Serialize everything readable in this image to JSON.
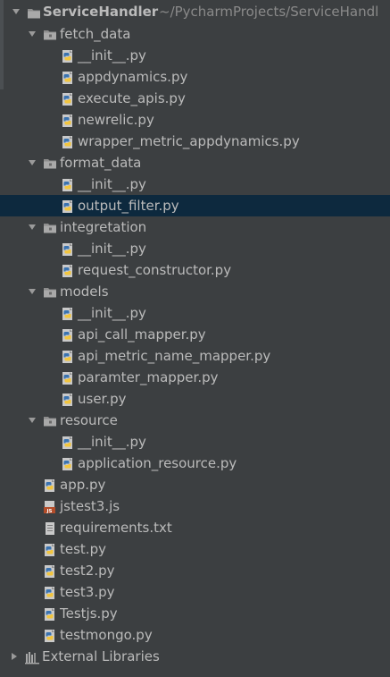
{
  "project_tree": {
    "root": {
      "name": "ServiceHandler",
      "path": "~/PycharmProjects/ServiceHandl"
    },
    "folders": [
      {
        "name": "fetch_data",
        "files": [
          "__init__.py",
          "appdynamics.py",
          "execute_apis.py",
          "newrelic.py",
          "wrapper_metric_appdynamics.py"
        ]
      },
      {
        "name": "format_data",
        "files": [
          "__init__.py",
          "output_filter.py"
        ]
      },
      {
        "name": "integretation",
        "files": [
          "__init__.py",
          "request_constructor.py"
        ]
      },
      {
        "name": "models",
        "files": [
          "__init__.py",
          "api_call_mapper.py",
          "api_metric_name_mapper.py",
          "paramter_mapper.py",
          "user.py"
        ]
      },
      {
        "name": "resource",
        "files": [
          "__init__.py",
          "application_resource.py"
        ]
      }
    ],
    "root_files": [
      "app.py",
      "jstest3.js",
      "requirements.txt",
      "test.py",
      "test2.py",
      "test3.py",
      "Testjs.py",
      "testmongo.py"
    ],
    "selected_file": "output_filter.py",
    "external_libraries": "External Libraries"
  },
  "icons": {
    "python_file": "python-file-icon",
    "js_file": "javascript-file-icon",
    "text_file": "text-file-icon",
    "folder": "folder-icon",
    "project_folder": "project-folder-icon",
    "libraries": "external-libraries-icon"
  },
  "colors": {
    "background": "#3c3f41",
    "selection": "#0d293e",
    "text": "#bbbbbb",
    "muted": "#8a8a8a"
  }
}
